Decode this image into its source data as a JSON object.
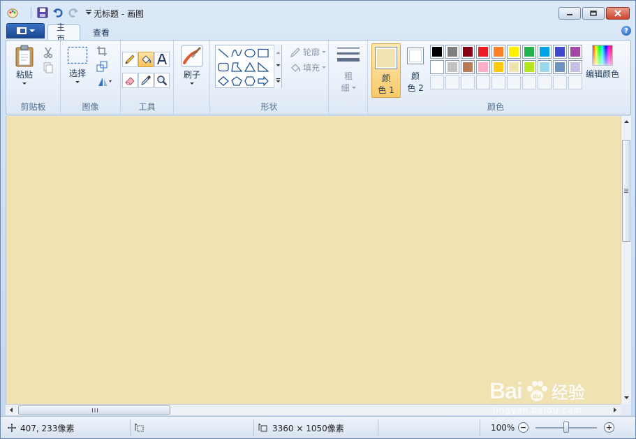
{
  "window": {
    "title": "无标题 - 画图"
  },
  "tabs": {
    "home": "主页",
    "view": "查看"
  },
  "ribbon": {
    "clipboard": {
      "group_label": "剪贴板",
      "paste_label": "粘贴"
    },
    "image": {
      "group_label": "图像",
      "select_label": "选择"
    },
    "tools": {
      "group_label": "工具"
    },
    "brushes": {
      "label": "刷子"
    },
    "shapes": {
      "group_label": "形状",
      "outline_label": "轮廓",
      "fill_label": "填充"
    },
    "size": {
      "label_line1": "粗",
      "label_line2": "细"
    },
    "colors": {
      "group_label": "颜色",
      "color1_line1": "颜",
      "color1_line2": "色 1",
      "color2_line1": "颜",
      "color2_line2": "色 2",
      "color1_value": "#f0e3b1",
      "color2_value": "#ffffff",
      "edit_colors_label": "编辑颜色",
      "palette_row1": [
        "#000000",
        "#7f7f7f",
        "#880015",
        "#ed1c24",
        "#ff7f27",
        "#fff200",
        "#22b14c",
        "#00a2e8",
        "#3f48cc",
        "#a349a4"
      ],
      "palette_row2": [
        "#ffffff",
        "#c3c3c3",
        "#b97a57",
        "#ffaec9",
        "#ffc90e",
        "#efe4b0",
        "#b5e61d",
        "#99d9ea",
        "#7092be",
        "#c8bfe7"
      ]
    }
  },
  "canvas": {
    "background": "#f0e3b1"
  },
  "statusbar": {
    "cursor_position": "407, 233像素",
    "image_size": "3360 × 1050像素",
    "zoom": "100%"
  },
  "watermark": {
    "brand": "Bai",
    "brand_cn": "经验",
    "url": "jingyan.baidu.com"
  }
}
